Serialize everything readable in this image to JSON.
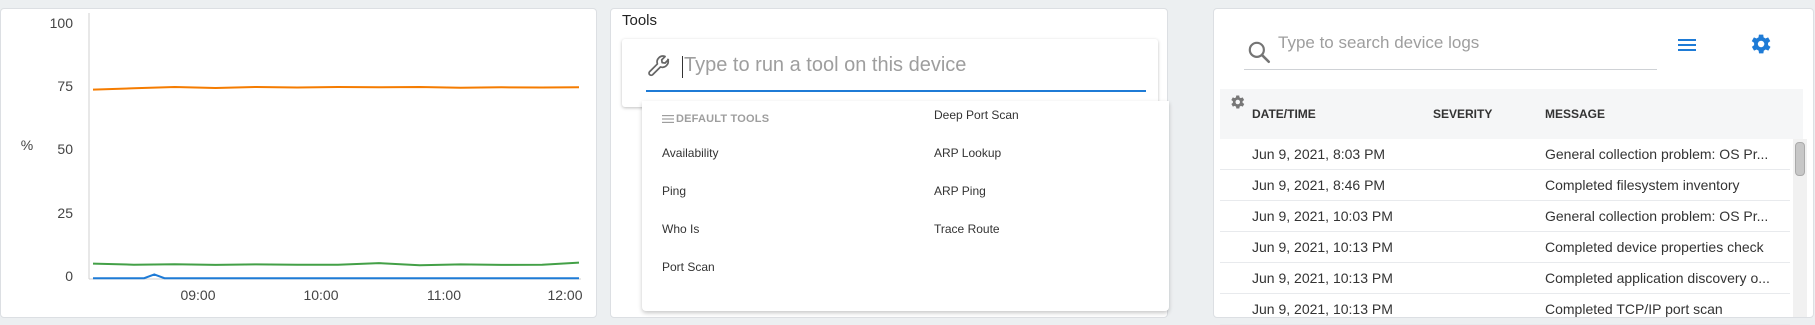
{
  "chart": {
    "ylabel": "%",
    "yticks": [
      "100",
      "75",
      "50",
      "25",
      "0"
    ],
    "xticks": [
      "09:00",
      "10:00",
      "11:00",
      "12:00"
    ]
  },
  "chart_data": {
    "type": "line",
    "ylabel": "%",
    "ylim": [
      0,
      100
    ],
    "x_ticks": [
      "09:00",
      "10:00",
      "11:00",
      "12:00"
    ],
    "x_range": [
      "08:10",
      "12:08"
    ],
    "grid": false,
    "series": [
      {
        "color": "#f57c00",
        "x": [
          "08:10",
          "08:30",
          "08:50",
          "09:10",
          "09:30",
          "09:50",
          "10:10",
          "10:30",
          "10:50",
          "11:10",
          "11:30",
          "11:50",
          "12:08"
        ],
        "values": [
          74,
          74.5,
          75,
          74.6,
          75,
          74.8,
          75,
          74.9,
          75,
          74.7,
          74.9,
          74.8,
          74.9
        ]
      },
      {
        "color": "#43a047",
        "x": [
          "08:10",
          "08:30",
          "08:50",
          "09:10",
          "09:30",
          "09:50",
          "10:10",
          "10:30",
          "10:50",
          "11:10",
          "11:30",
          "11:50",
          "12:08"
        ],
        "values": [
          6,
          5.6,
          5.8,
          5.5,
          5.7,
          5.6,
          5.6,
          6.2,
          5.4,
          5.7,
          5.5,
          5.6,
          6.4
        ]
      },
      {
        "color": "#1e7bd6",
        "x": [
          "08:10",
          "08:30",
          "08:35",
          "08:40",
          "08:45",
          "09:10",
          "09:50",
          "10:30",
          "11:10",
          "11:50",
          "12:08"
        ],
        "values": [
          0.3,
          0.3,
          0.3,
          1.8,
          0.3,
          0.3,
          0.3,
          0.3,
          0.3,
          0.3,
          0.3
        ]
      }
    ]
  },
  "tools": {
    "title": "Tools",
    "placeholder": "Type to run a tool on this device",
    "dropdown_header": "DEFAULT TOOLS",
    "left_items": [
      "Availability",
      "Ping",
      "Who Is",
      "Port Scan"
    ],
    "right_items": [
      "Deep Port Scan",
      "ARP Lookup",
      "ARP Ping",
      "Trace Route"
    ]
  },
  "logs": {
    "search_placeholder": "Type to search device logs",
    "columns": {
      "datetime": "DATE/TIME",
      "severity": "SEVERITY",
      "message": "MESSAGE"
    },
    "rows": [
      {
        "datetime": "Jun 9, 2021, 8:03 PM",
        "severity": "",
        "message": "General collection problem: OS Pr..."
      },
      {
        "datetime": "Jun 9, 2021, 8:46 PM",
        "severity": "",
        "message": "Completed filesystem inventory"
      },
      {
        "datetime": "Jun 9, 2021, 10:03 PM",
        "severity": "",
        "message": "General collection problem: OS Pr..."
      },
      {
        "datetime": "Jun 9, 2021, 10:13 PM",
        "severity": "",
        "message": "Completed device properties check"
      },
      {
        "datetime": "Jun 9, 2021, 10:13 PM",
        "severity": "",
        "message": "Completed application discovery o..."
      },
      {
        "datetime": "Jun 9, 2021, 10:13 PM",
        "severity": "",
        "message": "Completed TCP/IP port scan"
      }
    ],
    "accent": "#1e7bd6"
  },
  "icons": [
    "wrench-icon",
    "search-icon",
    "menu-icon",
    "gear-icon"
  ]
}
